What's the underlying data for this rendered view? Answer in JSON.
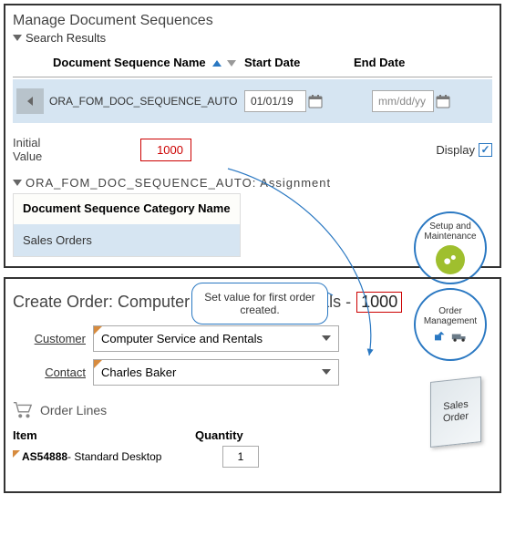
{
  "top": {
    "title": "Manage Document Sequences",
    "subtitle": "Search Results",
    "columns": {
      "seqname": "Document Sequence Name",
      "start": "Start Date",
      "end": "End Date"
    },
    "row": {
      "name": "ORA_FOM_DOC_SEQUENCE_AUTO",
      "start": "01/01/19",
      "end_placeholder": "mm/dd/yy"
    },
    "initial_label_l1": "Initial",
    "initial_label_l2": "Value",
    "initial_value": "1000",
    "display_label": "Display",
    "display_checked": "✓",
    "assignment_heading": "ORA_FOM_DOC_SEQUENCE_AUTO: Assignment",
    "category_header": "Document Sequence Category Name",
    "category_value": "Sales Orders",
    "badge_label": "Setup and Maintenance"
  },
  "callout_text": "Set value for first order created.",
  "bottom": {
    "title_prefix": "Create Order: Computer Service and Rentals -",
    "order_number": "1000",
    "customer_label": "Customer",
    "customer_value": "Computer Service and Rentals",
    "contact_label": "Contact",
    "contact_value": "Charles Baker",
    "order_lines_label": "Order Lines",
    "col_item": "Item",
    "col_qty": "Quantity",
    "item_sku": "AS54888",
    "item_desc": "- Standard Desktop",
    "qty": "1",
    "badge_label": "Order Management",
    "sales_card_l1": "Sales",
    "sales_card_l2": "Order"
  }
}
